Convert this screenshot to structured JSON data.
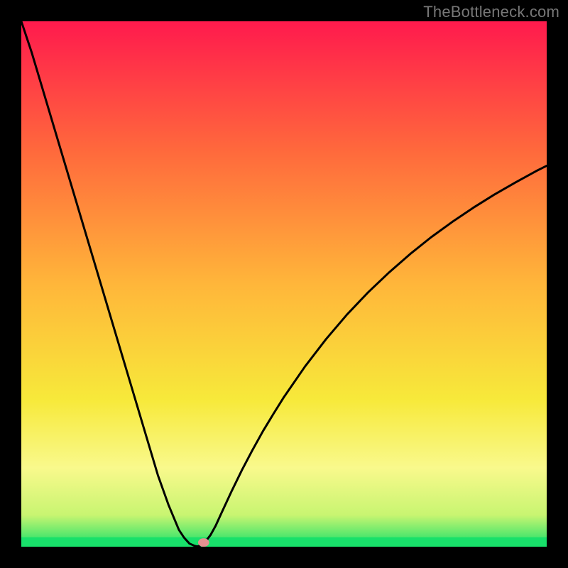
{
  "watermark": "TheBottleneck.com",
  "chart_data": {
    "type": "line",
    "title": "",
    "xlabel": "",
    "ylabel": "",
    "xlim": [
      0,
      100
    ],
    "ylim": [
      0,
      100
    ],
    "grid": false,
    "legend": false,
    "background_gradient_stops": [
      {
        "offset": 0.0,
        "color": "#ff1a4d"
      },
      {
        "offset": 0.25,
        "color": "#ff6a3c"
      },
      {
        "offset": 0.5,
        "color": "#ffb63a"
      },
      {
        "offset": 0.72,
        "color": "#f7e93a"
      },
      {
        "offset": 0.85,
        "color": "#f9f98c"
      },
      {
        "offset": 0.94,
        "color": "#c8f571"
      },
      {
        "offset": 1.0,
        "color": "#18e06a"
      }
    ],
    "bottom_band_color": "#18e06a",
    "bottom_band_height_frac": 0.018,
    "series": [
      {
        "name": "bottleneck-curve",
        "color": "#000000",
        "stroke_width": 3,
        "x": [
          0,
          2,
          4,
          6,
          8,
          10,
          12,
          14,
          16,
          18,
          20,
          22,
          24,
          26,
          28,
          30,
          31,
          32,
          33,
          33.5,
          34,
          35,
          36,
          37,
          38,
          40,
          42,
          44,
          46,
          48,
          50,
          54,
          58,
          62,
          66,
          70,
          74,
          78,
          82,
          86,
          90,
          94,
          98,
          100
        ],
        "y": [
          100,
          94,
          87.3,
          80.6,
          73.9,
          67.2,
          60.5,
          53.8,
          47.1,
          40.4,
          33.7,
          27.0,
          20.3,
          13.6,
          8.0,
          3.2,
          1.7,
          0.6,
          0.15,
          0.05,
          0.2,
          0.9,
          2.2,
          4.0,
          6.2,
          10.5,
          14.6,
          18.4,
          22.0,
          25.3,
          28.5,
          34.3,
          39.5,
          44.2,
          48.4,
          52.2,
          55.7,
          58.9,
          61.8,
          64.5,
          67.0,
          69.3,
          71.5,
          72.5
        ]
      }
    ],
    "marker": {
      "x": 34.7,
      "y": 0.8,
      "r": 6,
      "color": "#e59090"
    }
  }
}
